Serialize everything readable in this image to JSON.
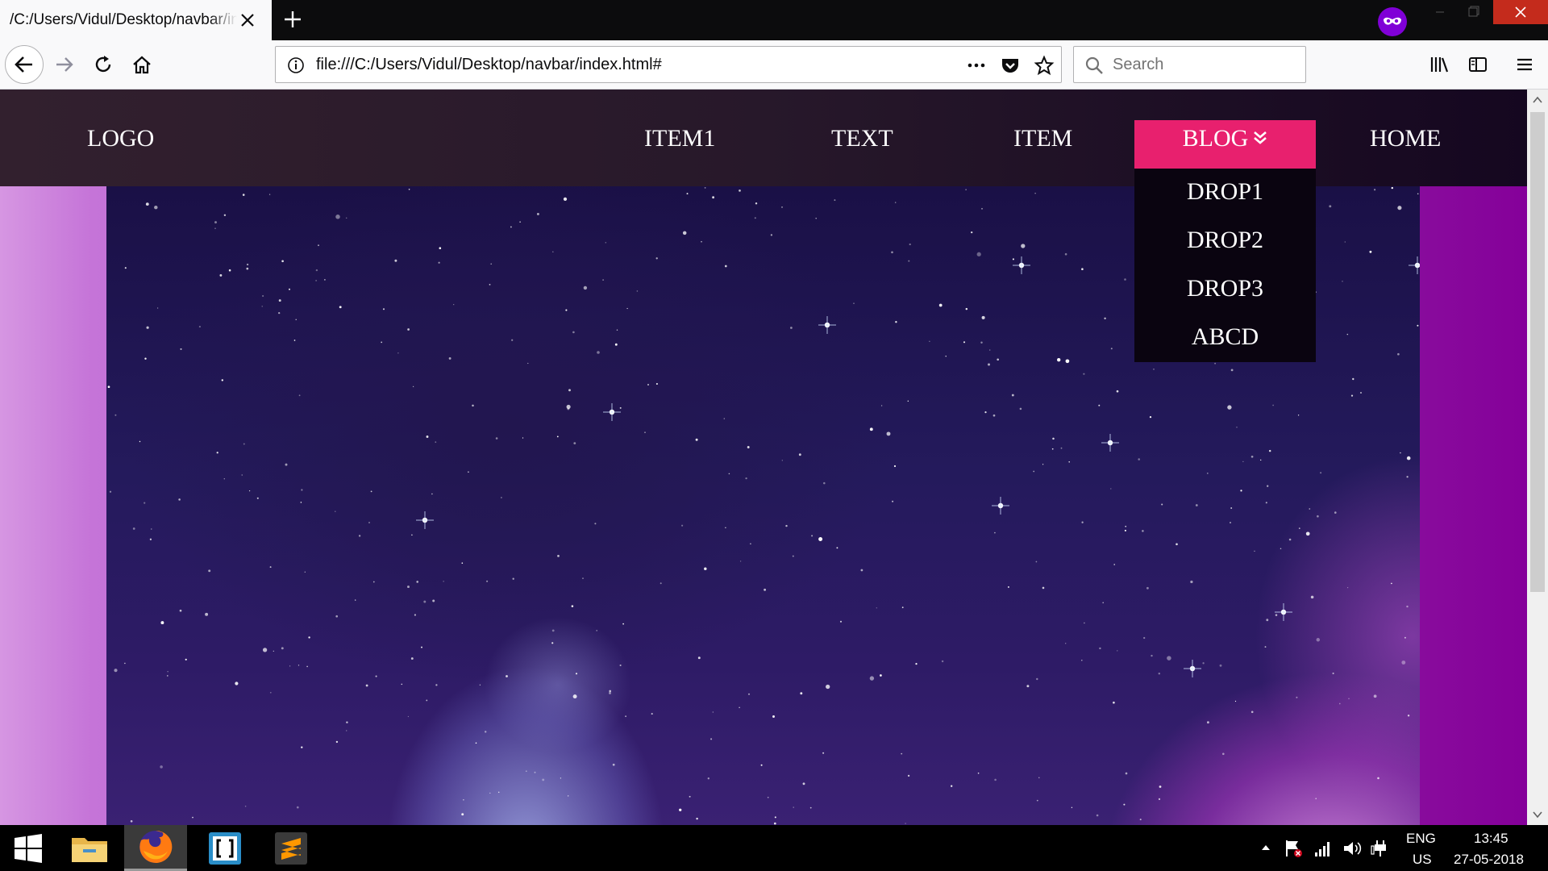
{
  "browser": {
    "tab_title": "/C:/Users/Vidul/Desktop/navbar/index.html",
    "url": "file:///C:/Users/Vidul/Desktop/navbar/index.html#",
    "search_placeholder": "Search"
  },
  "site": {
    "logo": "LOGO",
    "nav": [
      "ITEM1",
      "TEXT",
      "ITEM",
      "BLOG",
      "HOME"
    ],
    "dropdown": [
      "DROP1",
      "DROP2",
      "DROP3",
      "ABCD"
    ],
    "active_color": "#e8206e"
  },
  "taskbar": {
    "lang": "ENG",
    "region": "US",
    "time": "13:45",
    "date": "27-05-2018"
  },
  "icons": [
    "close-icon",
    "plus-icon",
    "private-browsing-icon",
    "minimize-icon",
    "restore-icon",
    "back-icon",
    "forward-icon",
    "reload-icon",
    "home-icon",
    "info-icon",
    "more-icon",
    "pocket-icon",
    "star-icon",
    "search-icon",
    "library-icon",
    "sidebar-icon",
    "menu-icon",
    "windows-icon",
    "file-explorer-icon",
    "firefox-icon",
    "brackets-icon",
    "sublime-icon"
  ]
}
